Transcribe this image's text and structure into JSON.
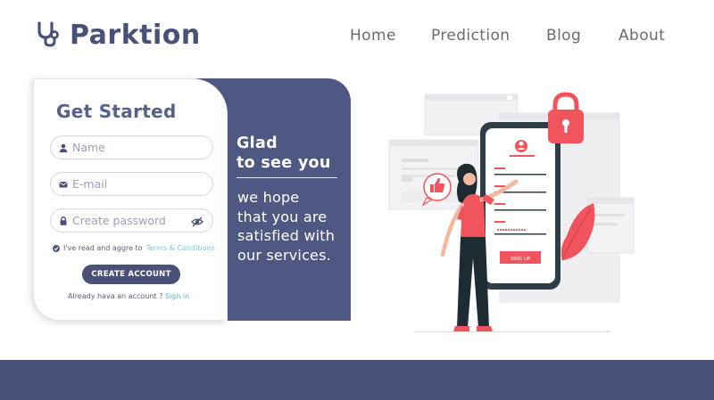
{
  "brand": {
    "name": "Parktion",
    "icon": "stethoscope-icon"
  },
  "nav": {
    "items": [
      "Home",
      "Prediction",
      "Blog",
      "About"
    ]
  },
  "form": {
    "title": "Get Started",
    "name_placeholder": "Name",
    "email_placeholder": "E-mail",
    "password_placeholder": "Create password",
    "terms_prefix": "I've read and aggre to",
    "terms_link": "Terms & Conditions",
    "submit_label": "CREATE ACCOUNT",
    "signin_prefix": "Already hava an account ?",
    "signin_link": "Sign in"
  },
  "welcome": {
    "headline_line1": "Glad",
    "headline_line2": "to see you",
    "body_line1": "we hope",
    "body_line2": "that you are",
    "body_line3": "satisfied with",
    "body_line4": "our services."
  },
  "illustration": {
    "phone_button": "SING UP"
  },
  "colors": {
    "primary": "#4a5178",
    "panel": "#4f5882",
    "accent_red": "#f0545c",
    "link": "#58b7d1"
  }
}
